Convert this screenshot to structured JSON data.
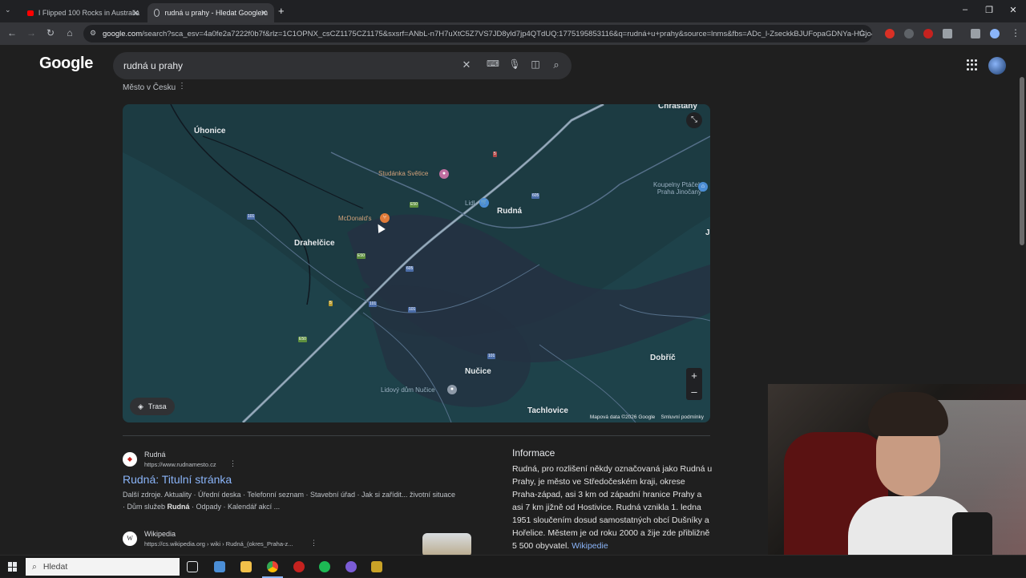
{
  "browser": {
    "tabs": [
      {
        "title": "I Flipped 100 Rocks in Australia",
        "active": false
      },
      {
        "title": "rudná u prahy - Hledat Googlem",
        "active": true
      }
    ],
    "url_host": "google.com",
    "url_rest": "/search?sca_esv=4a0fe2a7222f0b7f&rlz=1C1OPNX_csCZ1175CZ1175&sxsrf=ANbL-n7H7uXtC5Z7VS7JD8yld7jp4QTdUQ:1775195853116&q=rudná+u+prahy&source=lnms&fbs=ADc_l-ZseckkBJUFopaGDNYa-HGjo4..."
  },
  "search": {
    "logo": "Google",
    "query": "rudná u prahy"
  },
  "entity": {
    "type": "Město v Česku"
  },
  "map": {
    "towns": [
      "Úhonice",
      "Rudná",
      "Drahelčice",
      "Nučice",
      "Dobříč",
      "Tachlovice",
      "Chrastany",
      "J"
    ],
    "pois": [
      "Studánka Světice",
      "McDonald's",
      "Lidl",
      "Koupelny Ptáček Praha Jinočany",
      "Lidový dům Nučice"
    ],
    "route_label": "Trasa",
    "attribution": "Mapová data ©2026 Google",
    "terms": "Smluvní podmínky",
    "roads": [
      "E50",
      "E50",
      "E50",
      "101",
      "101",
      "101",
      "101",
      "5",
      "605",
      "605",
      "5"
    ]
  },
  "results": [
    {
      "site": "Rudná",
      "url": "https://www.rudnamesto.cz",
      "title": "Rudná: Titulní stránka",
      "snippet1": "Další zdroje. Aktuality · Úřední deska · Telefonní seznam · Stavební úřad · Jak si zařídit... životní situace",
      "snippet2_pre": "· Dům služeb ",
      "snippet2_bold": "Rudná",
      "snippet2_post": " · Odpady · Kalendář akcí ..."
    },
    {
      "site": "Wikipedia",
      "url": "https://cs.wikipedia.org › wiki › Rudná_(okres_Praha-z..."
    }
  ],
  "info": {
    "heading": "Informace",
    "text": "Rudná, pro rozlišení někdy označovaná jako Rudná u Prahy, je město ve Středočeském kraji, okrese Praha-západ, asi 3 km od západní hranice Prahy a asi 7 km jižně od Hostivice. Rudná vznikla 1. ledna 1951 sloučením dosud samostatných obcí Dušníky a Hořelice. Městem je od roku 2000 a žije zde přibližně 5 500 obyvatel.",
    "source": "Wikipedie"
  },
  "taskbar": {
    "search_placeholder": "Hledat"
  }
}
